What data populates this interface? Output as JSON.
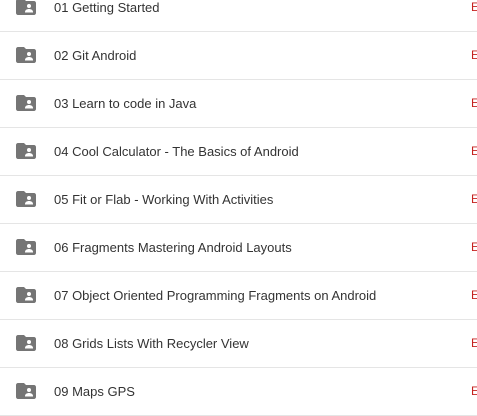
{
  "folder_icon": "shared-folder-icon",
  "icon_color": "#757575",
  "trailing_color": "#c5221f",
  "rows": [
    {
      "label": "01 Getting Started",
      "trailing": "E"
    },
    {
      "label": "02 Git Android",
      "trailing": "E"
    },
    {
      "label": "03 Learn to code in Java",
      "trailing": "E"
    },
    {
      "label": "04 Cool Calculator - The Basics of Android",
      "trailing": "E"
    },
    {
      "label": "05 Fit or Flab - Working With Activities",
      "trailing": "E"
    },
    {
      "label": "06 Fragments Mastering Android Layouts",
      "trailing": "E"
    },
    {
      "label": "07 Object Oriented Programming Fragments on Android",
      "trailing": "E"
    },
    {
      "label": "08 Grids Lists With Recycler View",
      "trailing": "E"
    },
    {
      "label": "09 Maps GPS",
      "trailing": "E"
    }
  ]
}
